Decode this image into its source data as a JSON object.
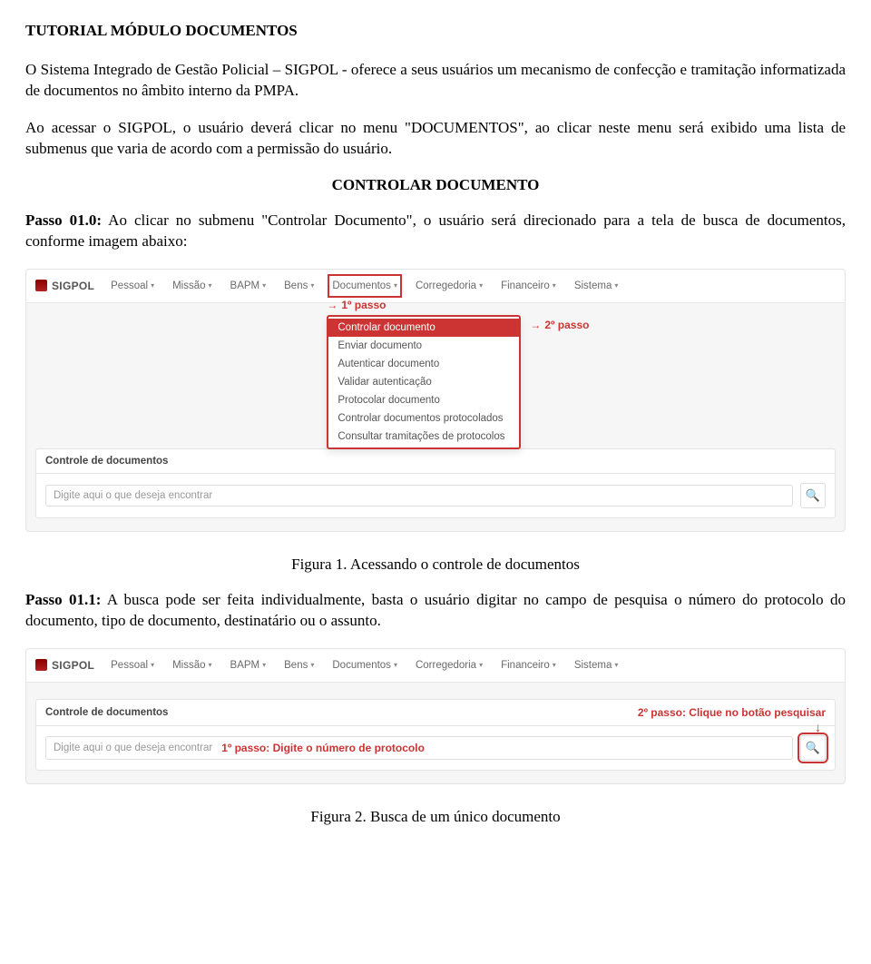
{
  "doc": {
    "title": "TUTORIAL MÓDULO DOCUMENTOS",
    "p1": "O Sistema Integrado de Gestão Policial – SIGPOL - oferece a seus usuários um mecanismo de confecção e tramitação informatizada de documentos no âmbito interno da PMPA.",
    "p2": "Ao acessar o SIGPOL, o usuário deverá clicar no menu \"DOCUMENTOS\", ao clicar neste menu será exibido uma lista de submenus que varia de acordo com a permissão do usuário.",
    "section": "CONTROLAR DOCUMENTO",
    "step0_label": "Passo 01.0:",
    "step0_text": " Ao clicar no submenu \"Controlar Documento\", o usuário será direcionado para a tela de busca de documentos, conforme imagem abaixo:",
    "fig1": "Figura 1. Acessando o controle de documentos",
    "step1_label": "Passo 01.1:",
    "step1_text": " A busca pode ser feita individualmente, basta o usuário digitar no campo de pesquisa o número do protocolo do documento, tipo de documento, destinatário ou o assunto.",
    "fig2": "Figura 2. Busca de um único documento"
  },
  "app": {
    "brand": "SIGPOL",
    "menu": [
      "Pessoal",
      "Missão",
      "BAPM",
      "Bens",
      "Documentos",
      "Corregedoria",
      "Financeiro",
      "Sistema"
    ],
    "dropdown": [
      "Controlar documento",
      "Enviar documento",
      "Autenticar documento",
      "Validar autenticação",
      "Protocolar documento",
      "Controlar documentos protocolados",
      "Consultar tramitações de protocolos"
    ],
    "annot": {
      "step1": "1º passo",
      "step2": "2º passo",
      "step1_input": "1º passo: Digite o número de protocolo",
      "step2_btn": "2º passo: Clique no botão pesquisar"
    },
    "panel_title": "Controle de documentos",
    "placeholder": "Digite aqui o que deseja encontrar"
  }
}
